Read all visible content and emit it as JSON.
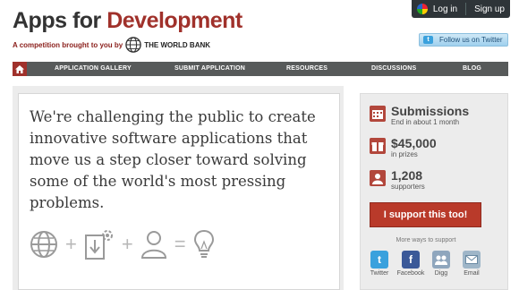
{
  "header": {
    "title_part1": "Apps for ",
    "title_part2": "Development",
    "tagline": "A competition brought to you by",
    "sponsor": "THE WORLD BANK",
    "login": "Log in",
    "signup": "Sign up",
    "twitter_follow": "Follow us on Twitter"
  },
  "nav": {
    "home_icon": "home-icon",
    "items": [
      "APPLICATION GALLERY",
      "SUBMIT APPLICATION",
      "RESOURCES",
      "DISCUSSIONS",
      "BLOG"
    ]
  },
  "hero": {
    "text": "We're challenging the public to create innovative software applications that move us a step closer toward solving some of the world's most pressing problems.",
    "icons": [
      "globe-icon",
      "download-gear-icon",
      "person-icon",
      "lightbulb-icon"
    ],
    "operators": [
      "+",
      "+",
      "="
    ]
  },
  "sidebar": {
    "submissions_title": "Submissions",
    "submissions_sub": "End in about 1 month",
    "prizes_value": "$45,000",
    "prizes_sub": "in prizes",
    "supporters_value": "1,208",
    "supporters_sub": "supporters",
    "support_button": "I support this too!",
    "more_ways": "More ways to support",
    "share": [
      {
        "label": "Twitter",
        "icon": "twitter-icon",
        "color": "#3aa1dd"
      },
      {
        "label": "Facebook",
        "icon": "facebook-icon",
        "color": "#3b5998"
      },
      {
        "label": "Digg",
        "icon": "digg-icon",
        "color": "#8fa6bd"
      },
      {
        "label": "Email",
        "icon": "email-icon",
        "color": "#9fb6c8"
      }
    ]
  },
  "colors": {
    "brand_red": "#a0312b",
    "nav_gray": "#575a5a",
    "button_red": "#b93a2a"
  }
}
